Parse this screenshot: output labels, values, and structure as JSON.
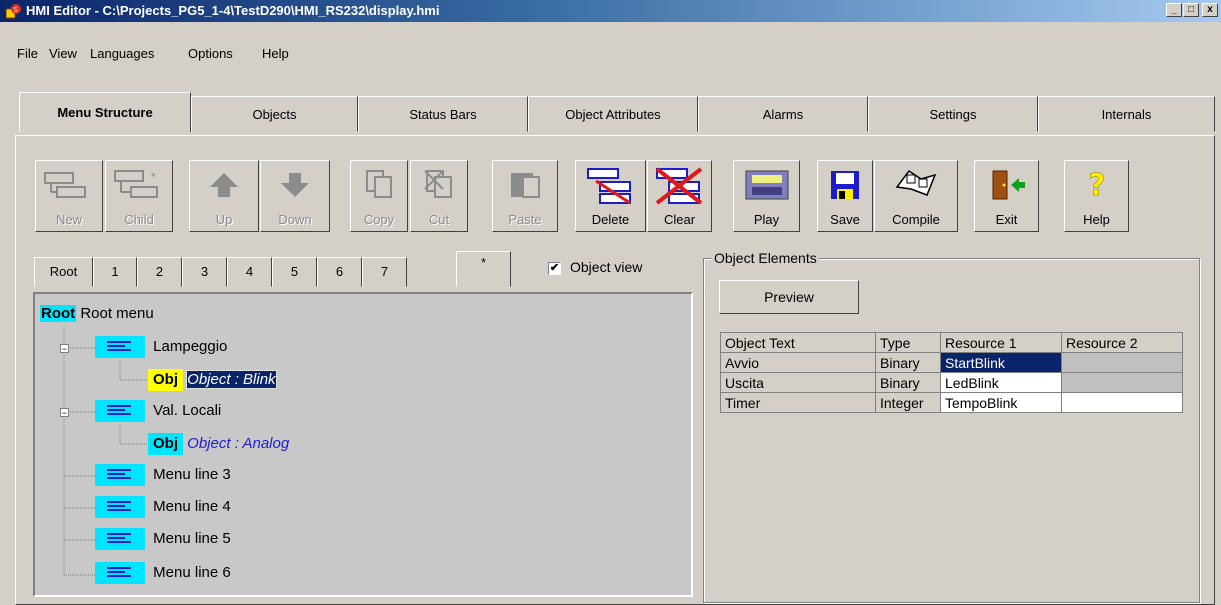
{
  "window": {
    "title": "HMI Editor - C:\\Projects_PG5_1-4\\TestD290\\HMI_RS232\\display.hmi",
    "minimize": "_",
    "maximize": "□",
    "close": "x"
  },
  "menu": [
    "File",
    "View",
    "Languages",
    "Options",
    "Help"
  ],
  "tabs": [
    "Menu Structure",
    "Objects",
    "Status Bars",
    "Object Attributes",
    "Alarms",
    "Settings",
    "Internals"
  ],
  "toolbar": {
    "new": "New",
    "child": "Child",
    "up": "Up",
    "down": "Down",
    "copy": "Copy",
    "cut": "Cut",
    "paste": "Paste",
    "delete": "Delete",
    "clear": "Clear",
    "play": "Play",
    "save": "Save",
    "compile": "Compile",
    "exit": "Exit",
    "help": "Help"
  },
  "subtabs": [
    "Root",
    "1",
    "2",
    "3",
    "4",
    "5",
    "6",
    "7",
    "*"
  ],
  "object_view": {
    "label": "Object view",
    "checked": true,
    "mark": "✔"
  },
  "tree": {
    "root_tag": "Root",
    "root_label": "Root menu",
    "items": [
      {
        "label": "Lampeggio"
      },
      {
        "obj_tag": "Obj",
        "label": "Object : Blink"
      },
      {
        "label": "Val. Locali"
      },
      {
        "obj_tag": "Obj",
        "label": "Object : Analog"
      },
      {
        "label": "Menu line 3"
      },
      {
        "label": "Menu line 4"
      },
      {
        "label": "Menu line 5"
      },
      {
        "label": "Menu line 6"
      }
    ]
  },
  "object_elements": {
    "group_label": "Object Elements",
    "preview": "Preview",
    "columns": [
      "Object Text",
      "Type",
      "Resource 1",
      "Resource 2"
    ],
    "rows": [
      [
        "Avvio",
        "Binary",
        "StartBlink",
        ""
      ],
      [
        "Uscita",
        "Binary",
        "LedBlink",
        ""
      ],
      [
        "Timer",
        "Integer",
        "TempoBlink",
        ""
      ]
    ]
  },
  "colors": {
    "title_bar_start": "#0a246a",
    "tree_label_bg": "#00e5ff",
    "obj_tag_selected": "#ffff00",
    "selection": "#0a246a"
  }
}
